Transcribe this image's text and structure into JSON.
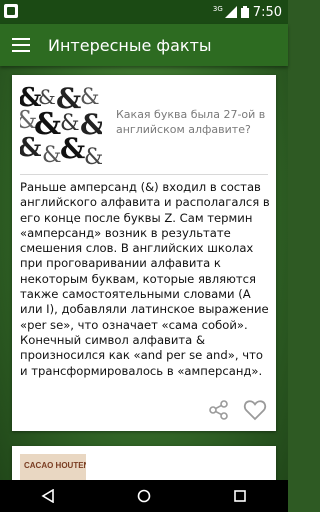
{
  "status": {
    "network": "3G",
    "time": "7:50"
  },
  "toolbar": {
    "title": "Интересные факты"
  },
  "card1": {
    "question": "Какая буква была 27-ой в английском алфавите?",
    "body": "Раньше амперсанд (&) входил в состав английского алфавита и располагался в его конце после буквы Z. Сам термин «амперсанд» возник в результате смешения слов. В английских школах при проговаривании алфавита к некоторым буквам, которые являются также самостоятельными словами (A или I), добавляли латинское выражение «per se», что означает «сама собой». Конечный символ алфавита & произносился как «and per se and», что и трансформировалось в «амперсанд».",
    "thumb_glyph": "&"
  },
  "card2": {
    "thumb_label": "CACAO HOUTEN"
  },
  "icons": {
    "menu": "menu-icon",
    "share": "share-icon",
    "favorite": "heart-outline-icon",
    "back": "back-icon",
    "home": "home-icon",
    "recents": "recents-icon"
  }
}
